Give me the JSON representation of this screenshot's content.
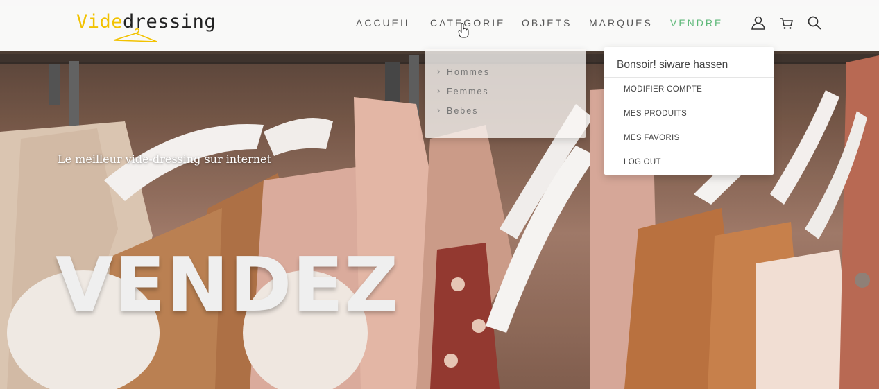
{
  "brand": {
    "part1": "Vide",
    "part2": "dressing"
  },
  "nav": {
    "items": [
      {
        "label": "ACCUEIL"
      },
      {
        "label": "CATEGORIE"
      },
      {
        "label": "OBJETS"
      },
      {
        "label": "MARQUES"
      },
      {
        "label": "VENDRE"
      }
    ]
  },
  "header_icons": [
    "user-icon",
    "cart-icon",
    "search-icon"
  ],
  "category_menu": {
    "items": [
      {
        "label": "Hommes"
      },
      {
        "label": "Femmes"
      },
      {
        "label": "Bebes"
      }
    ]
  },
  "account_menu": {
    "greeting": "Bonsoir! siware hassen",
    "items": [
      {
        "label": "MODIFIER COMPTE"
      },
      {
        "label": "MES PRODUITS"
      },
      {
        "label": "MES FAVORIS"
      },
      {
        "label": "LOG OUT"
      }
    ]
  },
  "hero": {
    "tagline": "Le meilleur vide-dressing sur internet",
    "title": "VENDEZ"
  },
  "colors": {
    "brand_yellow": "#f2c200",
    "highlight_yellow": "#f2d600",
    "accent_green": "#5db878"
  }
}
